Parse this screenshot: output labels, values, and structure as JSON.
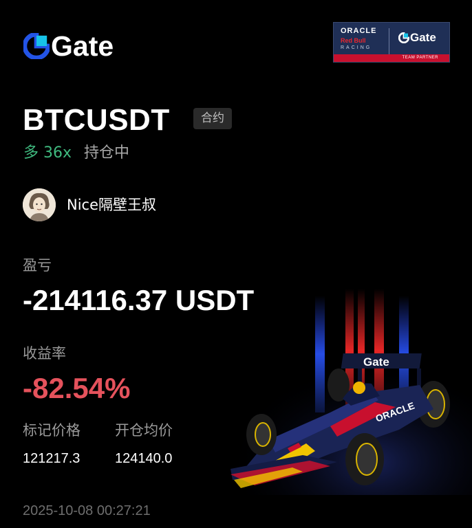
{
  "brand": {
    "logo_text": "Gate",
    "accent_color": "#17c3e8",
    "logo_blue": "#2354e6"
  },
  "partner_badge": {
    "oracle": "ORACLE",
    "red_bull": "Red Bull",
    "racing": "RACING",
    "gate": "Gate",
    "strip": "TEAM PARTNER"
  },
  "position": {
    "pair": "BTCUSDT",
    "type_tag": "合约",
    "side": "多 36x",
    "status": "持仓中",
    "side_color": "#3fba7f"
  },
  "user": {
    "name": "Nice隔壁王叔"
  },
  "stats": {
    "pnl_label": "盈亏",
    "pnl_value": "-214116.37 USDT",
    "roi_label": "收益率",
    "roi_value": "-82.54%",
    "roi_color": "#e5525c",
    "mark_price_label": "标记价格",
    "mark_price_value": "121217.3",
    "entry_price_label": "开仓均价",
    "entry_price_value": "124140.0"
  },
  "timestamp": "2025-10-08 00:27:21"
}
